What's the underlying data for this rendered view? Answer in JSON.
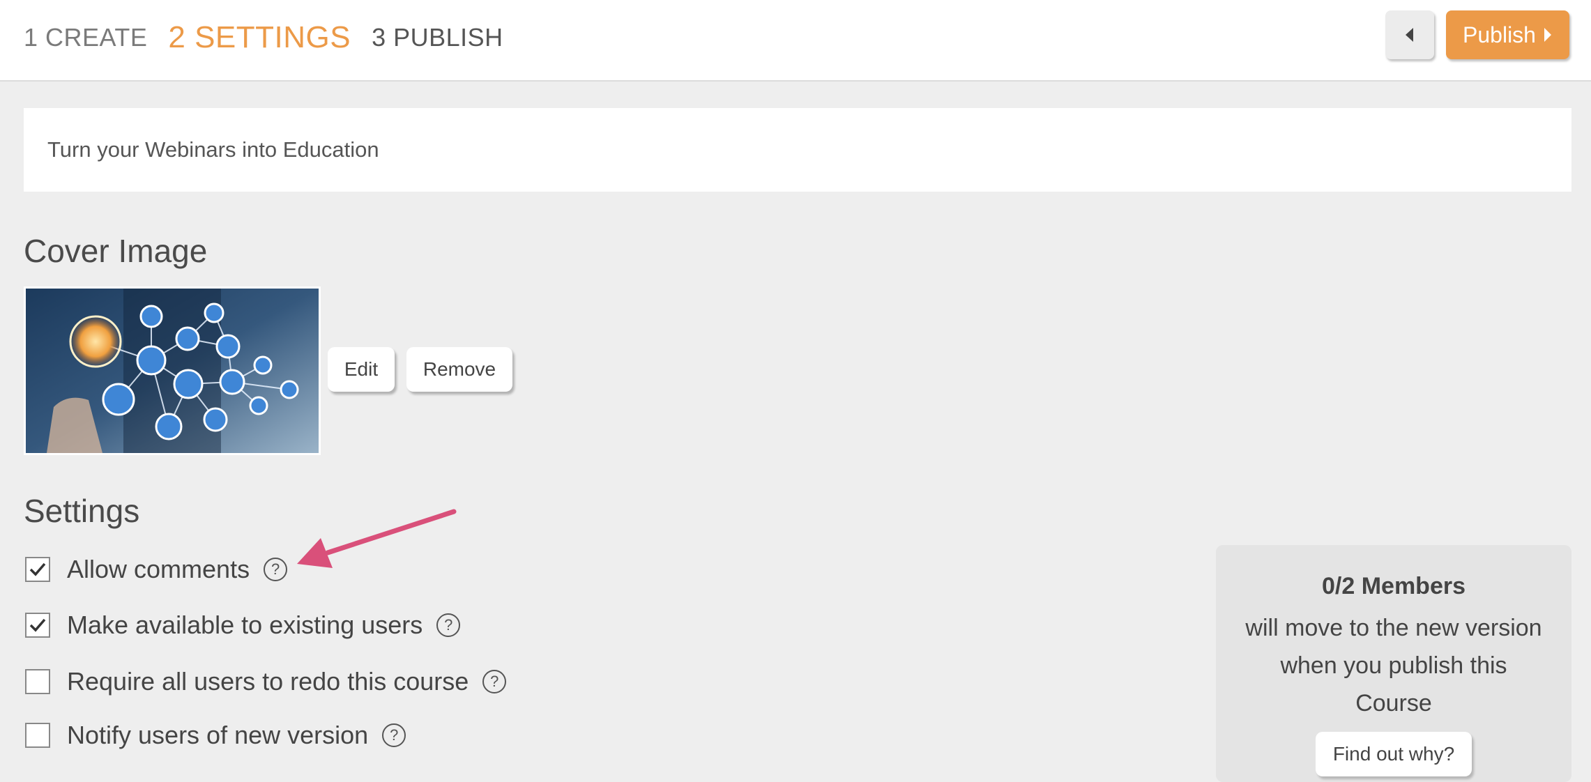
{
  "steps": [
    {
      "label": "1 CREATE"
    },
    {
      "label": "2 SETTINGS"
    },
    {
      "label": "3 PUBLISH"
    }
  ],
  "header": {
    "back_icon": "caret-left-icon",
    "publish_label": "Publish",
    "publish_icon": "caret-right-icon"
  },
  "course": {
    "title": "Turn your Webinars into Education"
  },
  "cover": {
    "heading": "Cover Image",
    "edit_label": "Edit",
    "remove_label": "Remove"
  },
  "settings": {
    "heading": "Settings",
    "options": [
      {
        "label": "Allow comments",
        "checked": true
      },
      {
        "label": "Make available to existing users",
        "checked": true
      },
      {
        "label": "Require all users to redo this course",
        "checked": false
      },
      {
        "label": "Notify users of new version",
        "checked": false
      }
    ],
    "help_glyph": "?"
  },
  "members": {
    "count": "0/2 Members",
    "text": "will move to the new version when you publish this Course",
    "find_label": "Find out why?"
  },
  "colors": {
    "accent": "#ec9a48",
    "annotation_arrow": "#d9507a"
  }
}
